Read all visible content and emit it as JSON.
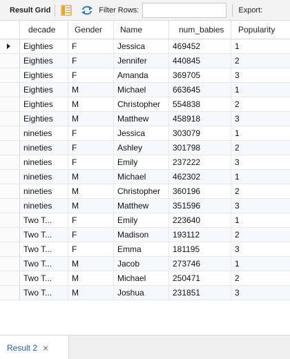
{
  "toolbar": {
    "result_grid_label": "Result Grid",
    "filter_label": "Filter Rows:",
    "filter_value": "",
    "export_label": "Export:"
  },
  "grid": {
    "columns": [
      "decade",
      "Gender",
      "Name",
      "num_babies",
      "Popularity"
    ],
    "rows": [
      [
        "Eighties",
        "F",
        "Jessica",
        "469452",
        "1"
      ],
      [
        "Eighties",
        "F",
        "Jennifer",
        "440845",
        "2"
      ],
      [
        "Eighties",
        "F",
        "Amanda",
        "369705",
        "3"
      ],
      [
        "Eighties",
        "M",
        "Michael",
        "663645",
        "1"
      ],
      [
        "Eighties",
        "M",
        "Christopher",
        "554838",
        "2"
      ],
      [
        "Eighties",
        "M",
        "Matthew",
        "458918",
        "3"
      ],
      [
        "nineties",
        "F",
        "Jessica",
        "303079",
        "1"
      ],
      [
        "nineties",
        "F",
        "Ashley",
        "301798",
        "2"
      ],
      [
        "nineties",
        "F",
        "Emily",
        "237222",
        "3"
      ],
      [
        "nineties",
        "M",
        "Michael",
        "462302",
        "1"
      ],
      [
        "nineties",
        "M",
        "Christopher",
        "360196",
        "2"
      ],
      [
        "nineties",
        "M",
        "Matthew",
        "351596",
        "3"
      ],
      [
        "Two T...",
        "F",
        "Emily",
        "223640",
        "1"
      ],
      [
        "Two T...",
        "F",
        "Madison",
        "193112",
        "2"
      ],
      [
        "Two T...",
        "F",
        "Emma",
        "181195",
        "3"
      ],
      [
        "Two T...",
        "M",
        "Jacob",
        "273746",
        "1"
      ],
      [
        "Two T...",
        "M",
        "Michael",
        "250471",
        "2"
      ],
      [
        "Two T...",
        "M",
        "Joshua",
        "231851",
        "3"
      ]
    ]
  },
  "tabs": [
    {
      "label": "Result 2",
      "close": "×"
    }
  ],
  "icons": {
    "form_editor": "form-editor-icon",
    "refresh": "refresh-icon",
    "current_row": "current-row-arrow-icon"
  },
  "colors": {
    "accent": "#1f5fa8",
    "row_alt": "#f5f8fd",
    "form_icon": "#e8a317"
  }
}
